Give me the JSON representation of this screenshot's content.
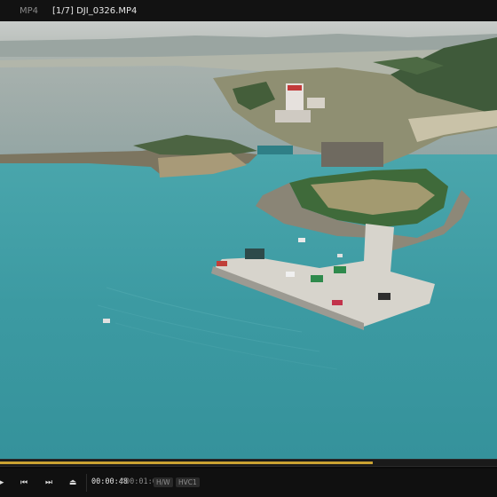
{
  "titlebar": {
    "format_label": "MP4",
    "file_title": "[1/7] DJI_0326.MP4"
  },
  "playback": {
    "current_time": "00:00:48",
    "separator": "/",
    "total_time": "00:01:04",
    "decode_badge": "H/W",
    "codec_badge": "HVC1",
    "progress_fraction": 0.75
  },
  "icons": {
    "play": "play-icon",
    "prev": "skip-back-icon",
    "next": "skip-forward-icon",
    "eject": "eject-icon"
  },
  "colors": {
    "progress": "#c9a232",
    "water": "#3f9fa5",
    "background": "#0b0b0b"
  }
}
